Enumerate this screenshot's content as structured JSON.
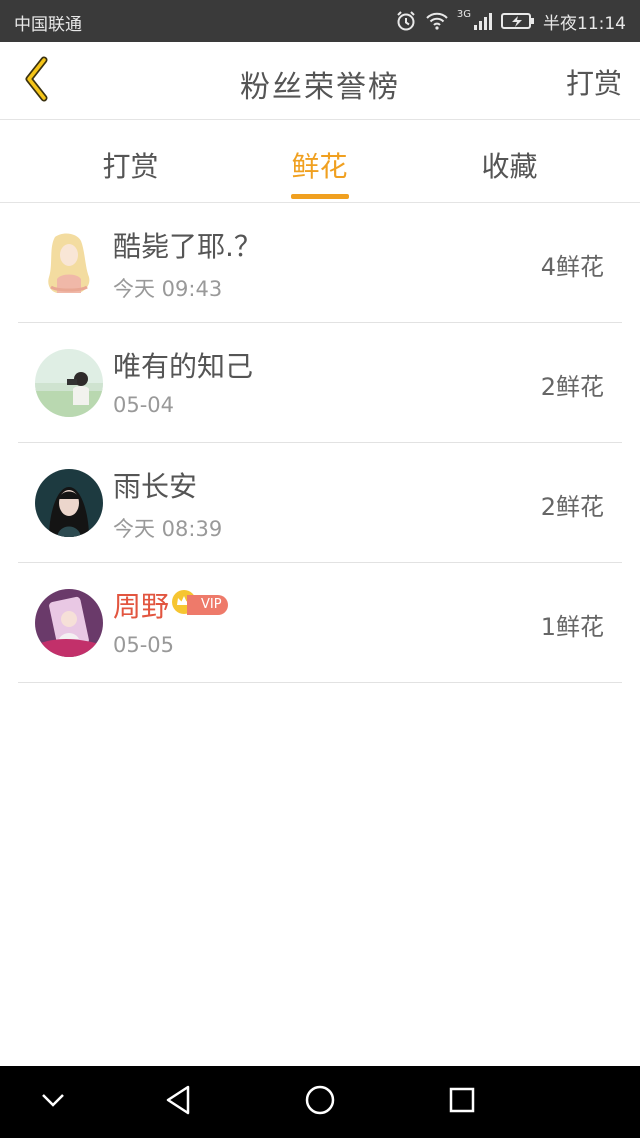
{
  "status_bar": {
    "carrier": "中国联通",
    "network": "3G",
    "time": "半夜11:14",
    "icons": [
      "alarm-icon",
      "wifi-icon",
      "signal-icon",
      "battery-icon"
    ]
  },
  "header": {
    "back_icon": "chevron-left-icon",
    "title": "粉丝荣誉榜",
    "action": "打赏"
  },
  "tabs": [
    {
      "label": "打赏",
      "active": false
    },
    {
      "label": "鲜花",
      "active": true
    },
    {
      "label": "收藏",
      "active": false
    }
  ],
  "fans": [
    {
      "name": "酷毙了耶.？",
      "time": "今天 09:43",
      "count": "4鲜花",
      "vip": false
    },
    {
      "name": "唯有的知己",
      "time": "05-04",
      "count": "2鲜花",
      "vip": false
    },
    {
      "name": "雨长安",
      "time": "今天 08:39",
      "count": "2鲜花",
      "vip": false
    },
    {
      "name": "周野",
      "time": "05-05",
      "count": "1鲜花",
      "vip": true,
      "vip_label": "VIP"
    }
  ],
  "colors": {
    "accent": "#f0a020",
    "vip_name": "#e2553f",
    "vip_badge": "#ee7a6a",
    "status_bar": "#3a3a3a",
    "nav_bar": "#000000"
  },
  "nav_bar": {
    "icons": [
      "chevron-down-icon",
      "back-triangle-icon",
      "home-circle-icon",
      "recents-square-icon"
    ]
  }
}
